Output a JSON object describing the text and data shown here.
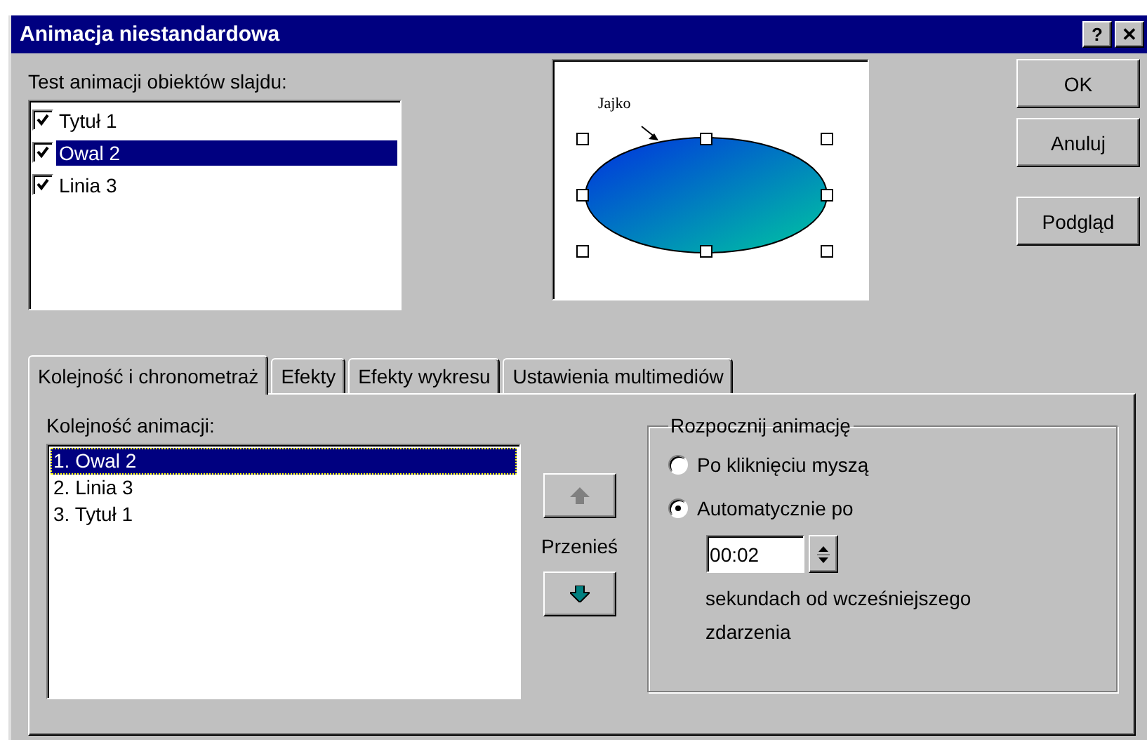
{
  "window": {
    "title": "Animacja niestandardowa",
    "help_button": "?",
    "close_button": "✕"
  },
  "objects": {
    "label": "Test animacji obiektów slajdu:",
    "items": [
      {
        "name": "Tytuł 1",
        "checked": true,
        "selected": false
      },
      {
        "name": "Owal 2",
        "checked": true,
        "selected": true
      },
      {
        "name": "Linia 3",
        "checked": true,
        "selected": false
      }
    ]
  },
  "preview": {
    "caption": "Jajko"
  },
  "buttons": [
    "OK",
    "Anuluj",
    "Podgląd"
  ],
  "tabs": [
    {
      "label": "Kolejność i chronometraż",
      "selected": true
    },
    {
      "label": "Efekty",
      "selected": false
    },
    {
      "label": "Efekty wykresu",
      "selected": false
    },
    {
      "label": "Ustawienia multimediów",
      "selected": false
    }
  ],
  "order": {
    "label": "Kolejność animacji:",
    "items": [
      {
        "name": "1. Owal 2",
        "selected": true
      },
      {
        "name": "2. Linia 3",
        "selected": false
      },
      {
        "name": "3. Tytuł 1",
        "selected": false
      }
    ],
    "move_label": "Przenieś",
    "move_up_disabled": true,
    "move_down_disabled": false
  },
  "start": {
    "legend": "Rozpocznij animację",
    "options": [
      {
        "label": "Po kliknięciu myszą",
        "selected": false
      },
      {
        "label": "Automatycznie po",
        "selected": true
      }
    ],
    "delay": "00:02",
    "delay_note": "sekundach od wcześniejszego zdarzenia"
  }
}
